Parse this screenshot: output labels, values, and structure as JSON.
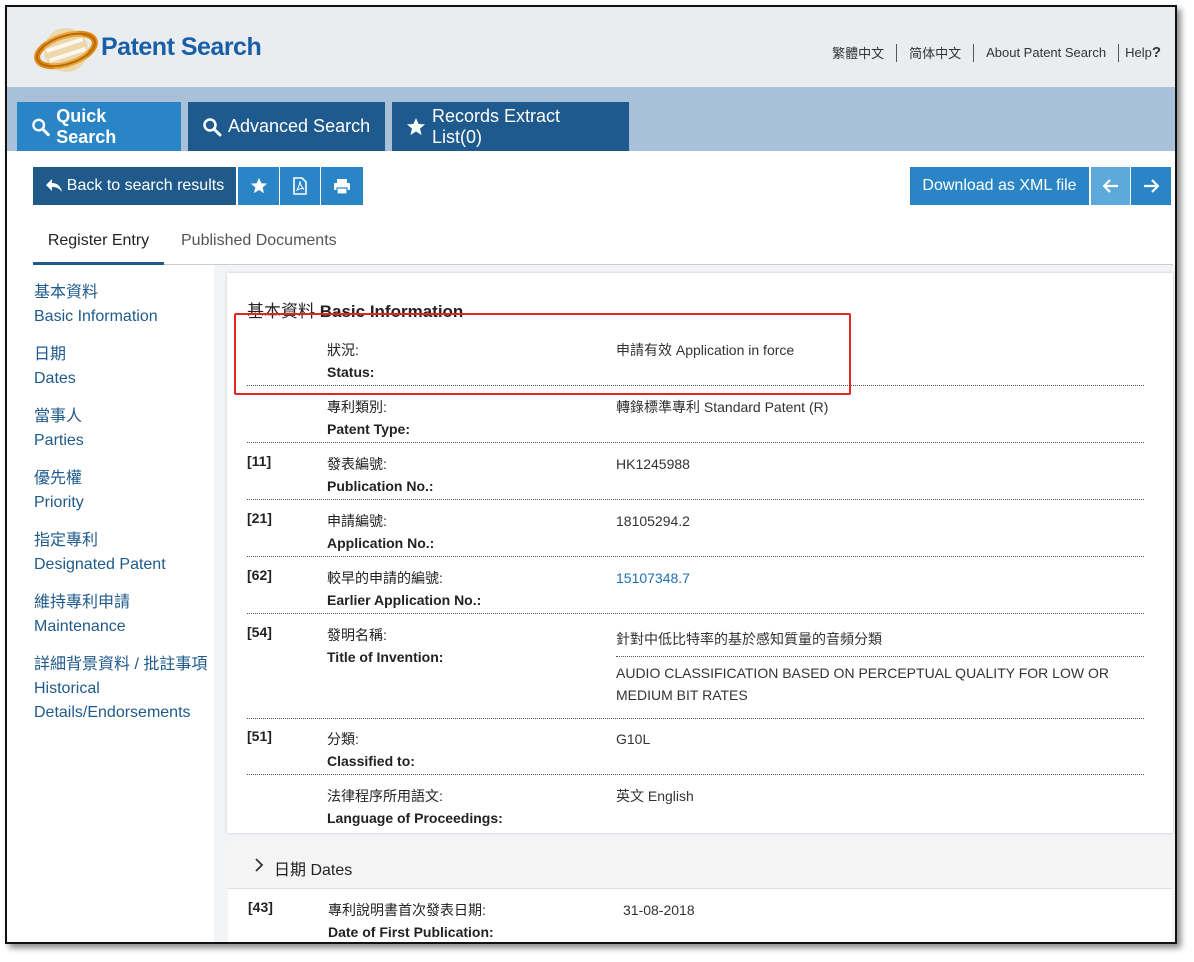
{
  "header": {
    "brand": "Patent Search",
    "links": [
      "繁體中文",
      "简体中文",
      "About Patent Search",
      "Help"
    ],
    "help_mark": "?"
  },
  "tabs": [
    {
      "label": "Quick Search",
      "icon": "search-icon"
    },
    {
      "label": "Advanced Search",
      "icon": "search-icon"
    },
    {
      "label": "Records Extract List(0)",
      "icon": "star-icon"
    }
  ],
  "toolbar": {
    "back_label": "Back to search results",
    "xml_label": "Download as XML file"
  },
  "entry_tabs": [
    "Register Entry",
    "Published Documents"
  ],
  "leftnav": [
    {
      "zh": "基本資料",
      "en": "Basic Information"
    },
    {
      "zh": "日期",
      "en": "Dates"
    },
    {
      "zh": "當事人",
      "en": "Parties"
    },
    {
      "zh": "優先權",
      "en": "Priority"
    },
    {
      "zh": "指定專利",
      "en": "Designated Patent"
    },
    {
      "zh": "維持專利申請",
      "en": "Maintenance"
    },
    {
      "zh": "詳細背景資料 / 批註事項",
      "en": "Historical Details/Endorsements"
    }
  ],
  "basic": {
    "title_zh": "基本資料",
    "title_en": "Basic Information",
    "rows": [
      {
        "code": "",
        "zh": "狀況:",
        "en": "Status:",
        "value": "申請有效 Application in force"
      },
      {
        "code": "",
        "zh": "專利類別:",
        "en": "Patent Type:",
        "value": "轉錄標準專利 Standard Patent (R)"
      },
      {
        "code": "[11]",
        "zh": "發表編號:",
        "en": "Publication No.:",
        "value": "HK1245988"
      },
      {
        "code": "[21]",
        "zh": "申請編號:",
        "en": "Application No.:",
        "value": "18105294.2"
      },
      {
        "code": "[62]",
        "zh": "較早的申請的編號:",
        "en": "Earlier Application No.:",
        "value": "15107348.7"
      },
      {
        "code": "[54]",
        "zh": "發明名稱:",
        "en": "Title of Invention:",
        "value": "針對中低比特率的基於感知質量的音頻分類",
        "value2a": "AUDIO CLASSIFICATION BASED ON PERCEPTUAL QUALITY FOR LOW OR",
        "value2b": "MEDIUM BIT RATES"
      },
      {
        "code": "[51]",
        "zh": "分類:",
        "en": "Classified to:",
        "value": "G10L"
      },
      {
        "code": "",
        "zh": "法律程序所用語文:",
        "en": "Language of Proceedings:",
        "value": "英文 English"
      }
    ]
  },
  "dates": {
    "title": "日期 Dates",
    "row": {
      "code": "[43]",
      "zh": "專利說明書首次發表日期:",
      "en": "Date of First Publication:",
      "value": "31-08-2018"
    }
  }
}
